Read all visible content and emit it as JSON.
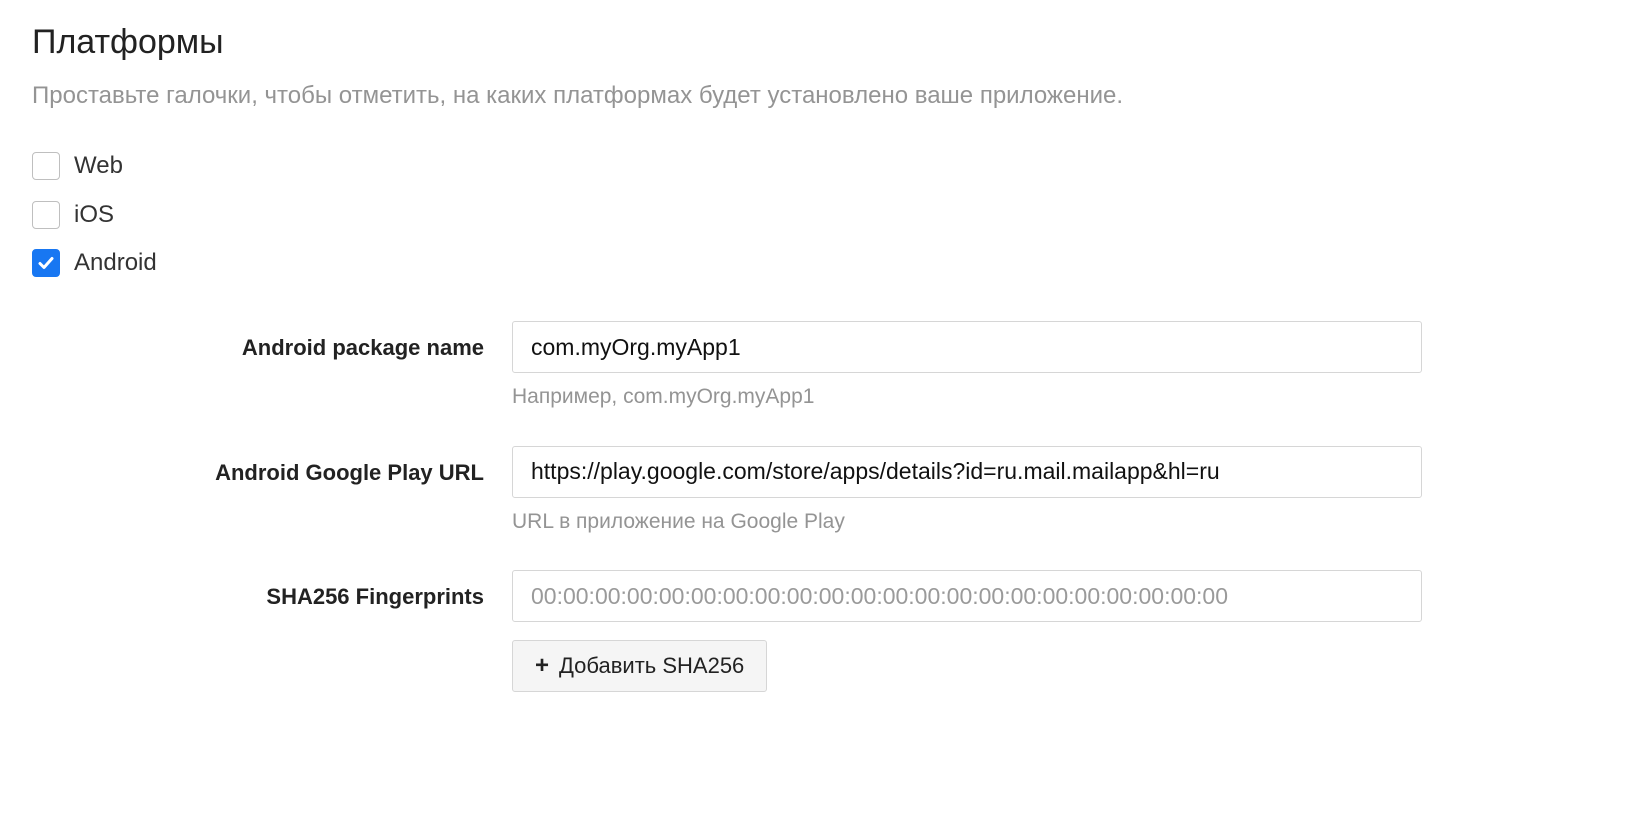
{
  "section": {
    "title": "Платформы",
    "description": "Проставьте галочки, чтобы отметить, на каких платформах будет установлено ваше приложение."
  },
  "platforms": {
    "web": {
      "label": "Web",
      "checked": false
    },
    "ios": {
      "label": "iOS",
      "checked": false
    },
    "android": {
      "label": "Android",
      "checked": true
    }
  },
  "android_form": {
    "package_name": {
      "label": "Android package name",
      "value": "com.myOrg.myApp1",
      "hint": "Например, com.myOrg.myApp1"
    },
    "play_url": {
      "label": "Android Google Play URL",
      "value": "https://play.google.com/store/apps/details?id=ru.mail.mailapp&hl=ru",
      "hint": "URL в приложение на Google Play"
    },
    "sha256": {
      "label": "SHA256 Fingerprints",
      "placeholder": "00:00:00:00:00:00:00:00:00:00:00:00:00:00:00:00:00:00:00:00:00:00",
      "value": "",
      "add_button": "Добавить SHA256"
    }
  }
}
